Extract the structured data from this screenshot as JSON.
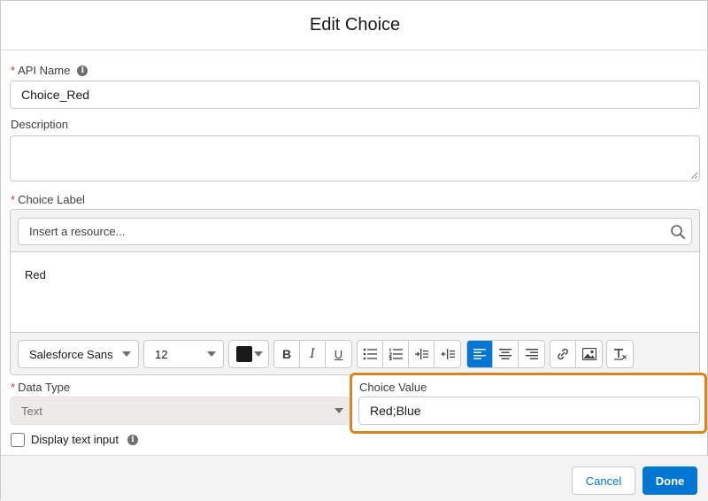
{
  "modal": {
    "title": "Edit Choice"
  },
  "api_name": {
    "required": "*",
    "label": "API Name",
    "info": "i",
    "value": "Choice_Red"
  },
  "description": {
    "label": "Description",
    "value": ""
  },
  "choice_label": {
    "required": "*",
    "label": "Choice Label",
    "resource_placeholder": "Insert a resource...",
    "content": "Red"
  },
  "toolbar": {
    "font_family": "Salesforce Sans",
    "font_size": "12",
    "text_color": "#1a1a1a",
    "bold": "B",
    "italic": "I",
    "underline": "U"
  },
  "data_type": {
    "required": "*",
    "label": "Data Type",
    "value": "Text"
  },
  "choice_value": {
    "label": "Choice Value",
    "value": "Red;Blue"
  },
  "display_text_input": {
    "label": "Display text input",
    "info": "i",
    "checked": false
  },
  "footer": {
    "cancel_label": "Cancel",
    "done_label": "Done"
  },
  "colors": {
    "brand": "#0176d3",
    "highlight": "#d8861f",
    "required": "#c23934"
  }
}
